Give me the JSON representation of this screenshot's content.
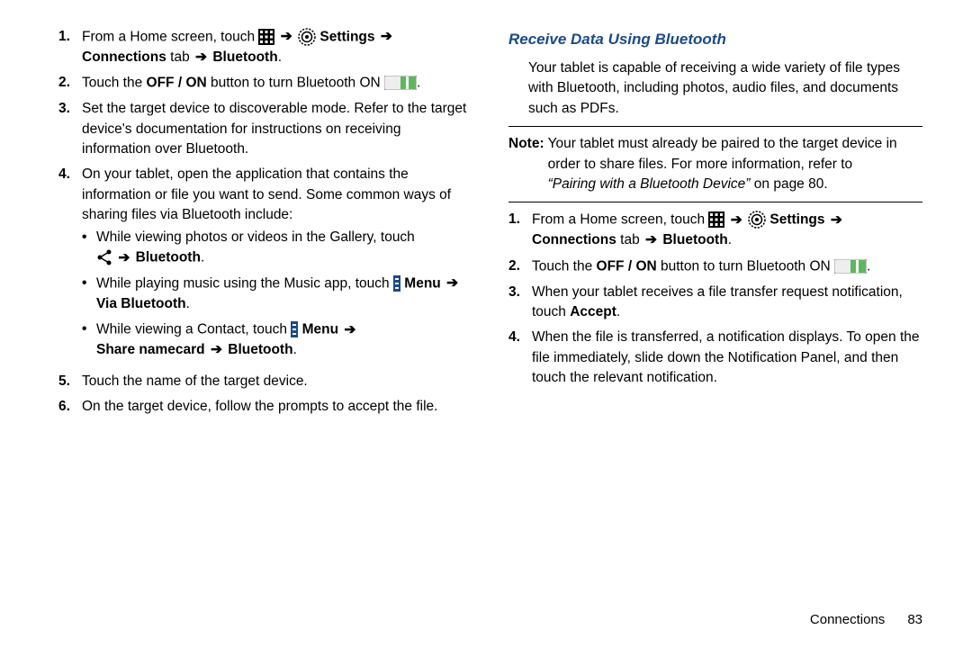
{
  "left": {
    "steps": [
      {
        "num": "1.",
        "pre": "From a Home screen, touch ",
        "settings": "Settings",
        "line2a": "Connections",
        "line2b": " tab ",
        "line2c": "Bluetooth",
        "line2d": "."
      },
      {
        "num": "2.",
        "pre": "Touch the ",
        "offon": "OFF / ON",
        "post": " button to turn Bluetooth ON ",
        "period": "."
      },
      {
        "num": "3.",
        "text": "Set the target device to discoverable mode. Refer to the target device's documentation for instructions on receiving information over Bluetooth."
      },
      {
        "num": "4.",
        "text": "On your tablet, open the application that contains the information or file you want to send. Some common ways of sharing files via Bluetooth include:",
        "bullets": [
          {
            "pre": "While viewing photos or videos in the Gallery, touch ",
            "bt": "Bluetooth",
            "post": "."
          },
          {
            "pre": "While playing music using the Music app, touch ",
            "menu": "Menu",
            "via": "Via Bluetooth",
            "post": "."
          },
          {
            "pre": "While viewing a Contact, touch ",
            "menu": "Menu",
            "share": "Share namecard",
            "bt": "Bluetooth",
            "post": "."
          }
        ]
      },
      {
        "num": "5.",
        "text": "Touch the name of the target device."
      },
      {
        "num": "6.",
        "text": "On the target device, follow the prompts to accept the file."
      }
    ]
  },
  "right": {
    "title": "Receive Data Using Bluetooth",
    "intro": "Your tablet is capable of receiving a wide variety of file types with Bluetooth, including photos, audio files, and documents such as PDFs.",
    "note_label": "Note:",
    "note_text_a": "Your tablet must already be paired to the target device in order to share files. For more information, refer to ",
    "note_ref": "“Pairing with a Bluetooth Device”",
    "note_text_b": " on page 80.",
    "steps": [
      {
        "num": "1.",
        "pre": "From a Home screen, touch ",
        "settings": "Settings",
        "line2a": "Connections",
        "line2b": " tab ",
        "line2c": "Bluetooth",
        "line2d": "."
      },
      {
        "num": "2.",
        "pre": "Touch the ",
        "offon": "OFF / ON",
        "post": " button to turn Bluetooth ON ",
        "period": "."
      },
      {
        "num": "3.",
        "text_a": "When your tablet receives a file transfer request notification, touch ",
        "accept": "Accept",
        "text_b": "."
      },
      {
        "num": "4.",
        "text": "When the file is transferred, a notification displays. To open the file immediately, slide down the Notification Panel, and then touch the relevant notification."
      }
    ]
  },
  "footer": {
    "section": "Connections",
    "page": "83"
  }
}
